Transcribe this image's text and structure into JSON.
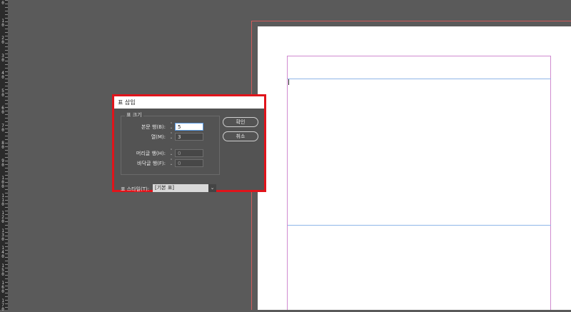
{
  "ruler": {
    "labels": [
      "0",
      "10",
      "20",
      "30",
      "40",
      "50",
      "60",
      "70",
      "80",
      "90",
      "100",
      "110",
      "120",
      "130",
      "140",
      "150",
      "160",
      "170"
    ]
  },
  "dialog": {
    "title": "표 삽입",
    "table_size_group": "표 크기",
    "body_rows_label": "본문 행(B):",
    "body_rows_value": "5",
    "columns_label": "열(M):",
    "columns_value": "3",
    "header_rows_label": "머리글 행(H):",
    "header_rows_value": "0",
    "footer_rows_label": "바닥글 행(F):",
    "footer_rows_value": "0",
    "ok_button": "확인",
    "cancel_button": "취소",
    "table_style_label": "표 스타일(T):",
    "table_style_value": "[기본 표]",
    "spinner_up": "⌃",
    "spinner_down": "⌄",
    "dropdown_arrow": "⌄"
  },
  "colors": {
    "highlight": "#e0141b",
    "pasteboard": "#5a5a5a",
    "margin_guide": "#d08ad0",
    "frame_guide": "#8fb6e8"
  }
}
